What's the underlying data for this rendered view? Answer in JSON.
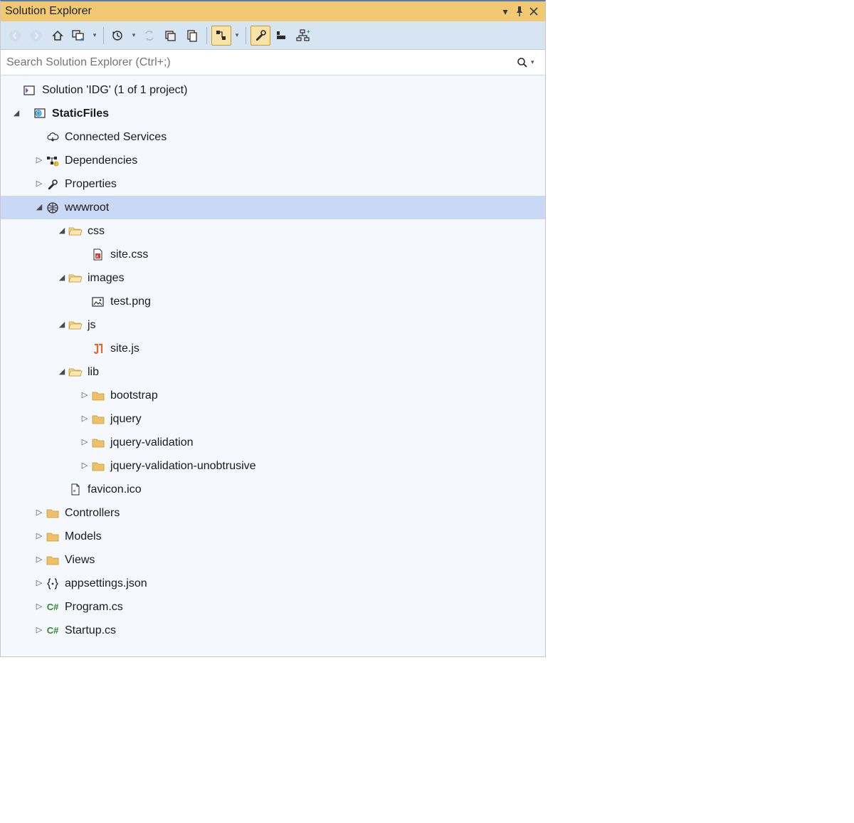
{
  "title": "Solution Explorer",
  "search": {
    "placeholder": "Search Solution Explorer (Ctrl+;)"
  },
  "solution": {
    "label": "Solution 'IDG' (1 of 1 project)",
    "project": {
      "label": "StaticFiles",
      "connected_services": "Connected Services",
      "dependencies": "Dependencies",
      "properties": "Properties",
      "wwwroot": {
        "label": "wwwroot",
        "css": {
          "label": "css",
          "file": "site.css"
        },
        "images": {
          "label": "images",
          "file": "test.png"
        },
        "js": {
          "label": "js",
          "file": "site.js"
        },
        "lib": {
          "label": "lib",
          "items": [
            "bootstrap",
            "jquery",
            "jquery-validation",
            "jquery-validation-unobtrusive"
          ]
        },
        "favicon": "favicon.ico"
      },
      "controllers": "Controllers",
      "models": "Models",
      "views": "Views",
      "appsettings": "appsettings.json",
      "program": "Program.cs",
      "startup": "Startup.cs"
    }
  }
}
